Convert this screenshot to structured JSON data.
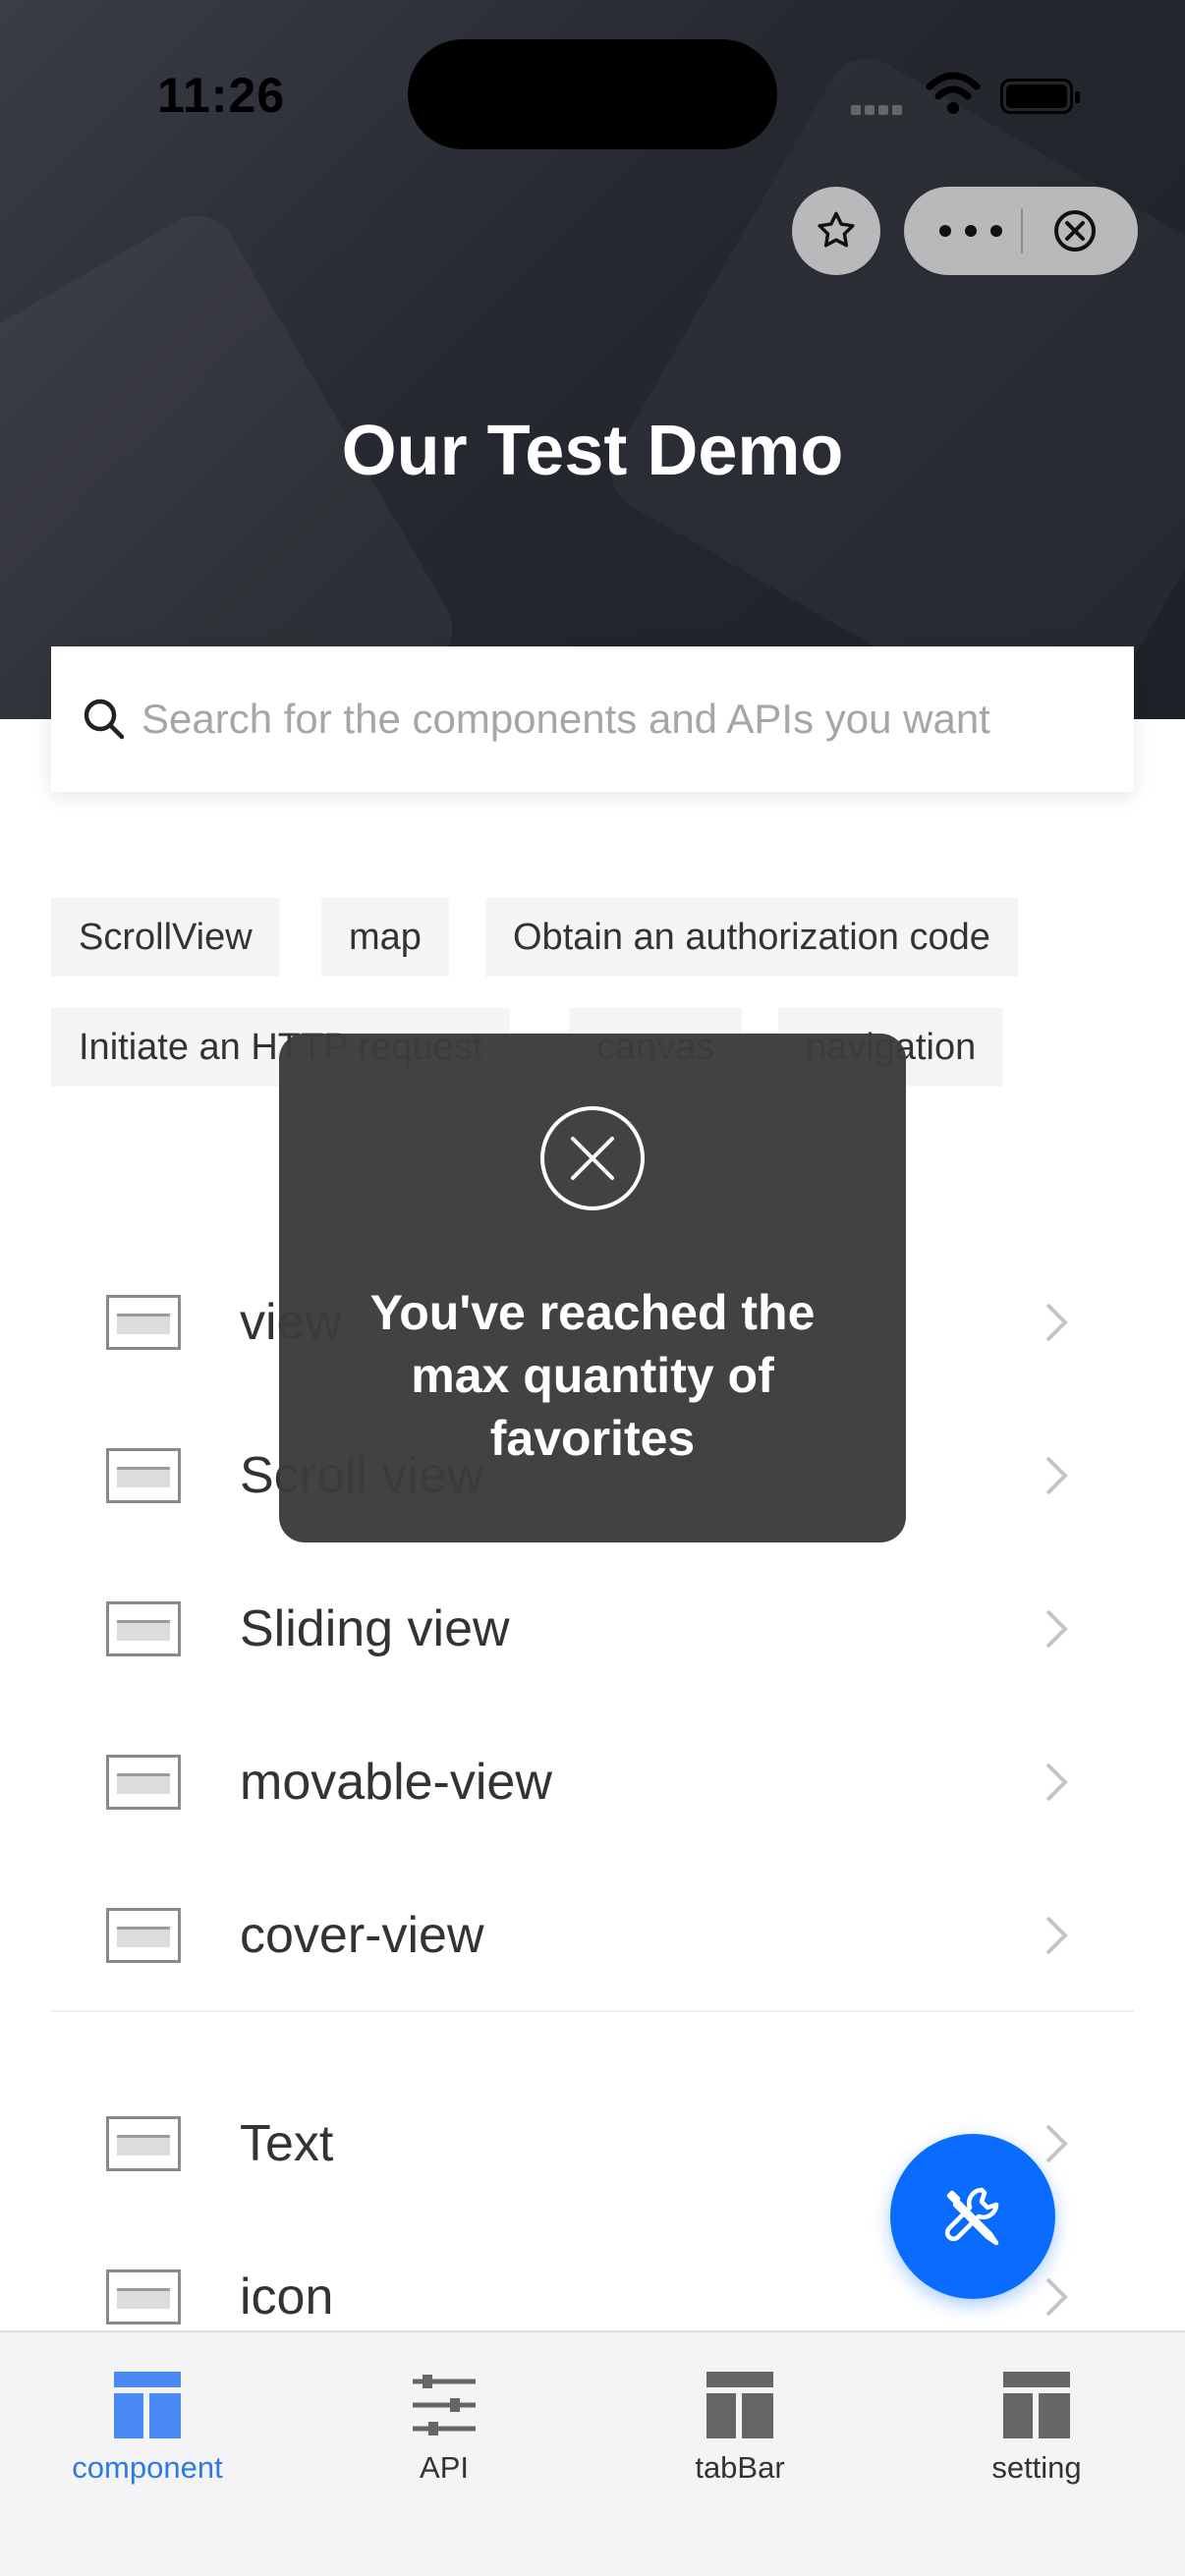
{
  "status_bar": {
    "time": "11:26"
  },
  "header": {
    "title": "Our Test Demo"
  },
  "search": {
    "placeholder": "Search for the components and APIs you want"
  },
  "tags": [
    "ScrollView",
    "map",
    "Obtain an authorization code",
    "Initiate an HTTP request",
    "canvas",
    "navigation"
  ],
  "list": {
    "items": [
      "view",
      "Scroll view",
      "Sliding view",
      "movable-view",
      "cover-view",
      "Text",
      "icon"
    ]
  },
  "toast": {
    "message": "You've reached the max quantity of favorites"
  },
  "tabbar": {
    "items": [
      {
        "label": "component",
        "active": true
      },
      {
        "label": "API",
        "active": false
      },
      {
        "label": "tabBar",
        "active": false
      },
      {
        "label": "setting",
        "active": false
      }
    ]
  },
  "colors": {
    "accent": "#0a6cff",
    "active_tab": "#2c7be5",
    "header_dark": "#262830"
  }
}
